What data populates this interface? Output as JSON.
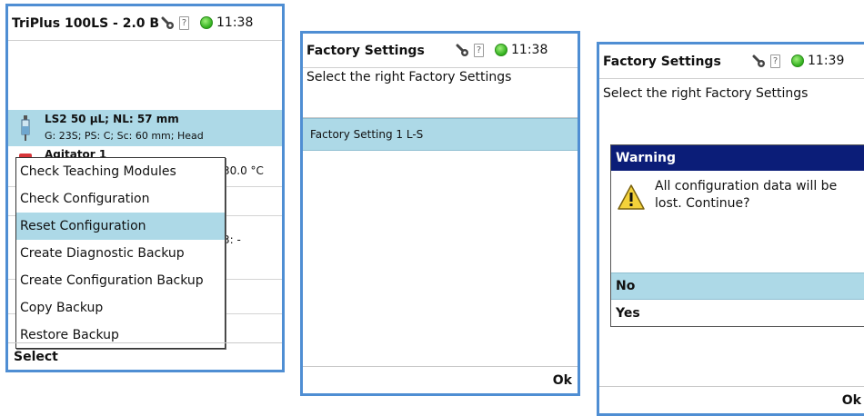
{
  "screen1": {
    "title": "TriPlus 100LS - 2.0 B",
    "time": "11:38",
    "syringe": {
      "line1": "LS2   50 µL; NL: 57 mm",
      "line2": "G: 23S; PS: C; Sc: 60 mm; Head"
    },
    "agitator": {
      "title": "Agitator 1",
      "temp": "30.0 °C"
    },
    "row_fragment": "3: -",
    "menu": [
      {
        "label": "Check Teaching Modules"
      },
      {
        "label": "Check Configuration"
      },
      {
        "label": "Reset Configuration"
      },
      {
        "label": "Create Diagnostic Backup"
      },
      {
        "label": "Create Configuration Backup"
      },
      {
        "label": "Copy Backup"
      },
      {
        "label": "Restore Backup"
      }
    ],
    "selected_menu_index": 2,
    "bottom_label": "Select"
  },
  "screen2": {
    "title": "Factory Settings",
    "time": "11:38",
    "prompt": "Select the right Factory Settings",
    "items": [
      {
        "label": "Factory Setting 1 L-S"
      }
    ],
    "bottom_label": "Ok"
  },
  "screen3": {
    "title": "Factory Settings",
    "time": "11:39",
    "prompt": "Select the right Factory Settings",
    "dialog": {
      "header": "Warning",
      "message": "All configuration data will be lost. Continue?",
      "options": [
        {
          "label": "No"
        },
        {
          "label": "Yes"
        }
      ],
      "selected_option_index": 0
    },
    "bottom_label": "Ok"
  },
  "icons": {
    "tool": "tool-icon",
    "usb": "usb-icon",
    "status_led": "status-led-icon",
    "syringe": "syringe-icon",
    "agitator": "agitator-icon",
    "warning": "warning-icon"
  },
  "colors": {
    "frame_border": "#4f8ed3",
    "selection": "#add9e7",
    "dialog_header": "#0b1d78",
    "status_led": "#2fae1c"
  }
}
